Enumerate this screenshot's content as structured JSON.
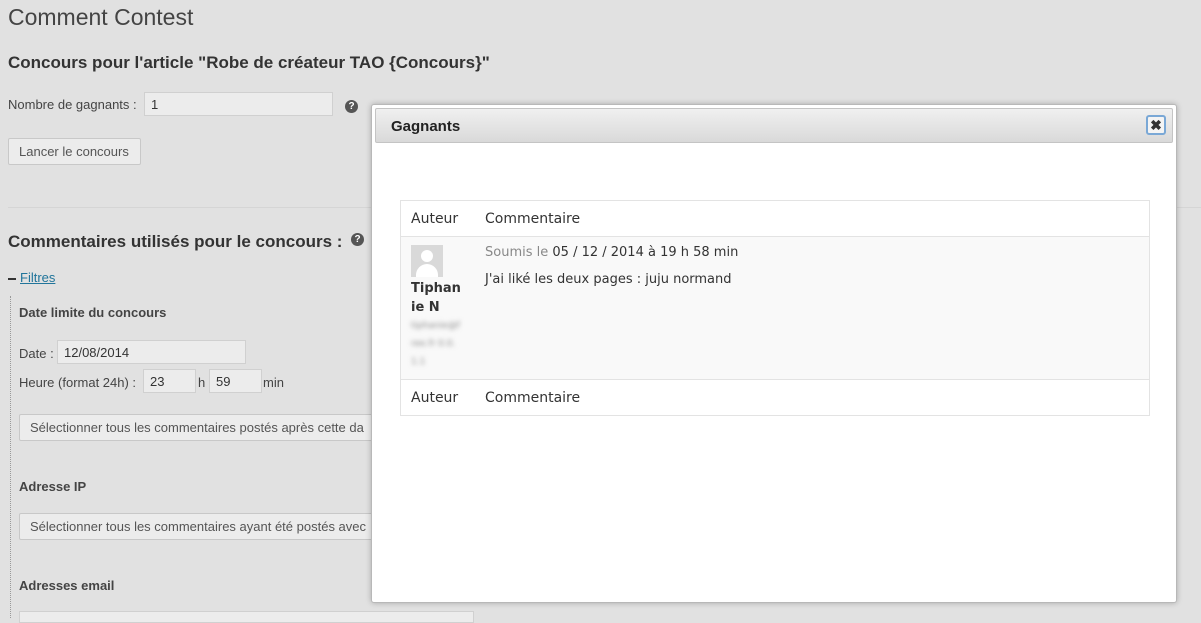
{
  "page": {
    "title": "Comment Contest",
    "contest_heading": "Concours pour l'article \"Robe de créateur TAO {Concours}\""
  },
  "winners_count": {
    "label": "Nombre de gagnants :",
    "value": "1"
  },
  "launch_button": "Lancer le concours",
  "comments_section": {
    "title": "Commentaires utilisés pour le concours :",
    "filters_link": "Filtres",
    "deadline": {
      "title": "Date limite du concours",
      "date_label": "Date :",
      "date_value": "12/08/2014",
      "hour_label": "Heure (format 24h) :",
      "hour_value": "23",
      "h_unit": "h",
      "minute_value": "59",
      "min_unit": "min",
      "select_button": "Sélectionner tous les commentaires postés après cette da"
    },
    "ip": {
      "title": "Adresse IP",
      "select_button": "Sélectionner tous les commentaires ayant été postés avec"
    },
    "email": {
      "title": "Adresses email"
    }
  },
  "modal": {
    "title": "Gagnants",
    "close_label": "✖",
    "columns": {
      "author": "Auteur",
      "comment": "Commentaire"
    },
    "rows": [
      {
        "author_name": "Tiphanie N",
        "author_extra": "tiphanie@free.fr 0.0.1.1",
        "submitted_prefix": "Soumis le",
        "submitted_date": "05 / 12 / 2014 à 19 h 58 min",
        "comment": "J'ai liké les deux pages : juju normand"
      }
    ]
  },
  "colors": {
    "link": "#21759b",
    "close_border": "#7aa8d6"
  },
  "icons": {
    "help": "help-icon",
    "minus": "minus-icon",
    "close": "close-icon",
    "avatar": "avatar-icon"
  }
}
